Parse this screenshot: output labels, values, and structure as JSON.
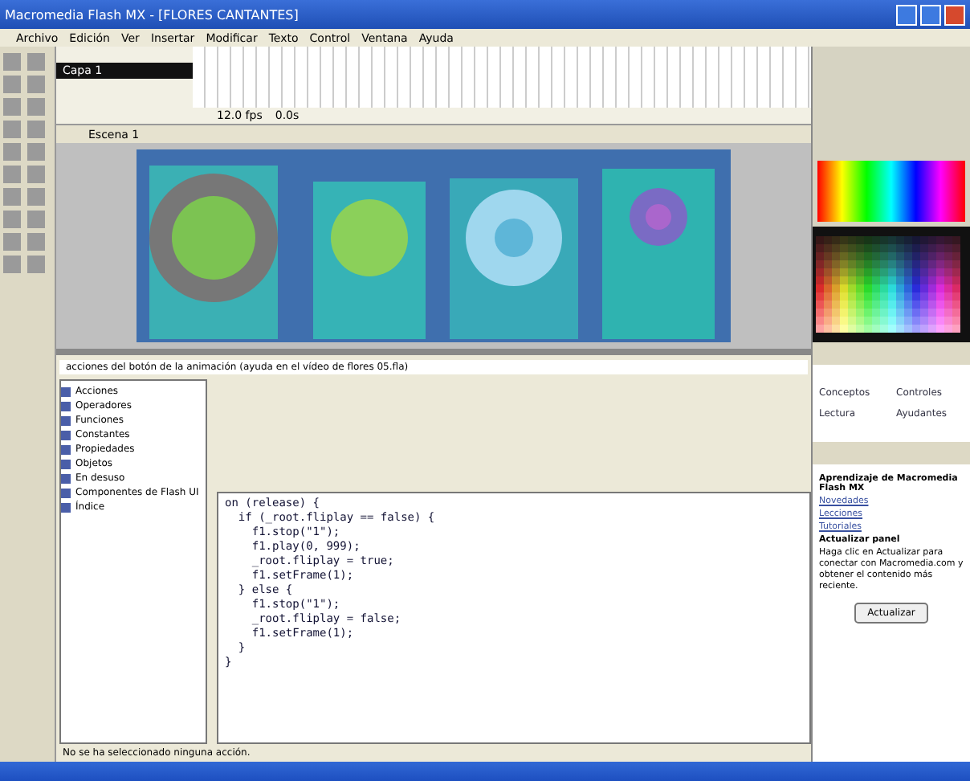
{
  "window": {
    "title": "Macromedia Flash MX - [FLORES CANTANTES]"
  },
  "menu": [
    "Archivo",
    "Edición",
    "Ver",
    "Insertar",
    "Modificar",
    "Texto",
    "Control",
    "Ventana",
    "Ayuda"
  ],
  "timeline": {
    "layer": "Capa 1",
    "fps": "12.0 fps",
    "time": "0.0s"
  },
  "scene": "Escena 1",
  "actions": {
    "hint": "acciones del botón de la animación (ayuda en el vídeo de flores 05.fla)",
    "categories": [
      {
        "label": "Acciones",
        "selected": false
      },
      {
        "label": "Operadores",
        "selected": false
      },
      {
        "label": "Funciones",
        "selected": false
      },
      {
        "label": "Constantes",
        "selected": false
      },
      {
        "label": "Propiedades",
        "selected": false
      },
      {
        "label": "Objetos",
        "selected": false
      },
      {
        "label": "En desuso",
        "selected": false
      },
      {
        "label": "Componentes de Flash UI",
        "selected": false
      },
      {
        "label": "Índice",
        "selected": false
      }
    ],
    "code": [
      "on (release) {",
      "  if (_root.fliplay == false) {",
      "    f1.stop(\"1\");",
      "    f1.play(0, 999);",
      "    _root.fliplay = true;",
      "    f1.setFrame(1);",
      "  } else {",
      "    f1.stop(\"1\");",
      "    _root.fliplay = false;",
      "    f1.setFrame(1);",
      "  }",
      "}"
    ],
    "status": "No se ha seleccionado ninguna acción."
  },
  "components": [
    "Conceptos",
    "Controles",
    "Lectura",
    "Ayudantes"
  ],
  "answers": {
    "title": "Aprendizaje de Macromedia Flash MX",
    "links": [
      "Novedades",
      "Lecciones",
      "Tutoriales"
    ],
    "update_title": "Actualizar panel",
    "update_text": "Haga clic en Actualizar para conectar con Macromedia.com y obtener el contenido más reciente.",
    "button": "Actualizar"
  }
}
